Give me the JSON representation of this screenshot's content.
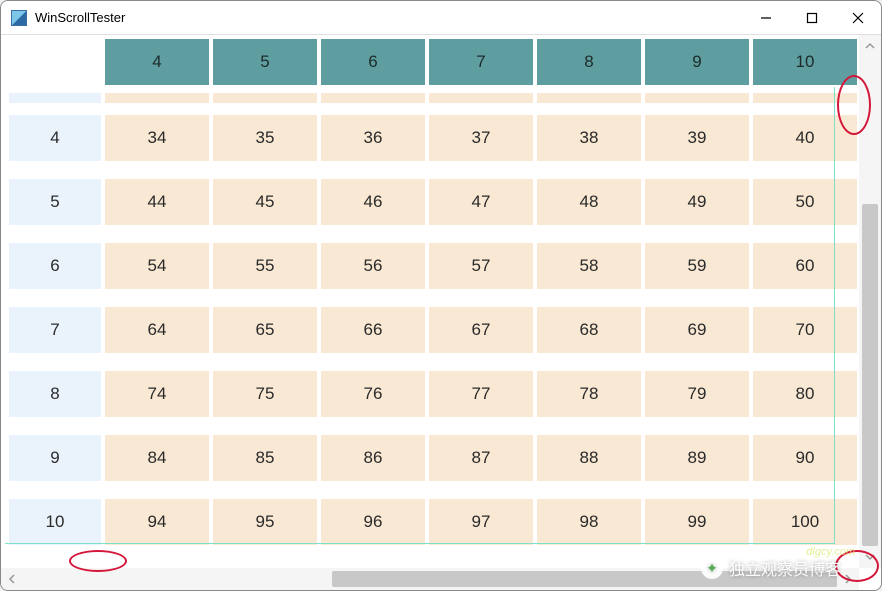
{
  "window": {
    "title": "WinScrollTester"
  },
  "chart_data": {
    "type": "table",
    "col_headers": [
      "4",
      "5",
      "6",
      "7",
      "8",
      "9",
      "10"
    ],
    "row_headers": [
      "",
      "4",
      "5",
      "6",
      "7",
      "8",
      "9",
      "10"
    ],
    "rows": [
      [
        "",
        "",
        "",
        "",
        "",
        "",
        ""
      ],
      [
        "34",
        "35",
        "36",
        "37",
        "38",
        "39",
        "40"
      ],
      [
        "44",
        "45",
        "46",
        "47",
        "48",
        "49",
        "50"
      ],
      [
        "54",
        "55",
        "56",
        "57",
        "58",
        "59",
        "60"
      ],
      [
        "64",
        "65",
        "66",
        "67",
        "68",
        "69",
        "70"
      ],
      [
        "74",
        "75",
        "76",
        "77",
        "78",
        "79",
        "80"
      ],
      [
        "84",
        "85",
        "86",
        "87",
        "88",
        "89",
        "90"
      ],
      [
        "94",
        "95",
        "96",
        "97",
        "98",
        "99",
        "100"
      ]
    ]
  },
  "scroll": {
    "v_thumb_top_pct": 30,
    "v_thumb_height_pct": 70,
    "h_thumb_left_pct": 38,
    "h_thumb_width_pct": 62
  },
  "watermark": {
    "text": "独立观察员博客",
    "sub": "dlgcy.com"
  }
}
